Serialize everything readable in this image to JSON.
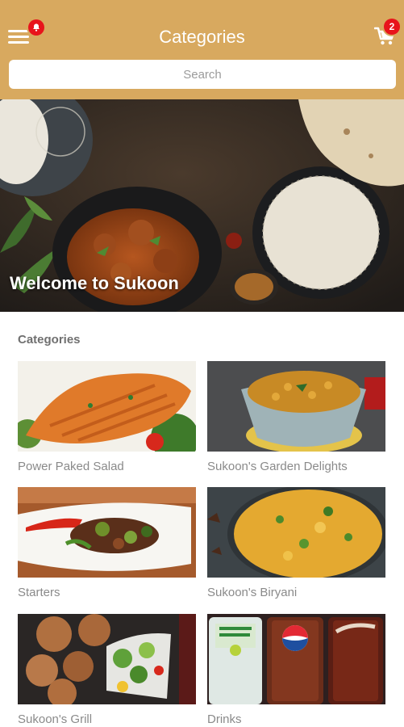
{
  "header": {
    "title": "Categories",
    "notification_count": "",
    "cart_count": "2",
    "accent_color": "#d8a95f",
    "badge_color": "#e8141b"
  },
  "search": {
    "placeholder": "Search"
  },
  "hero": {
    "welcome_text": "Welcome to Sukoon"
  },
  "section": {
    "title": "Categories"
  },
  "categories": [
    {
      "label": "Power Paked Salad",
      "image": "salmon-salad"
    },
    {
      "label": "Sukoon's Garden Delights",
      "image": "chickpea-curry"
    },
    {
      "label": "Starters",
      "image": "stir-fry-platter"
    },
    {
      "label": "Sukoon's Biryani",
      "image": "biryani-rice"
    },
    {
      "label": "Sukoon's Grill",
      "image": "grilled-chicken"
    },
    {
      "label": "Drinks",
      "image": "soft-drinks"
    }
  ]
}
